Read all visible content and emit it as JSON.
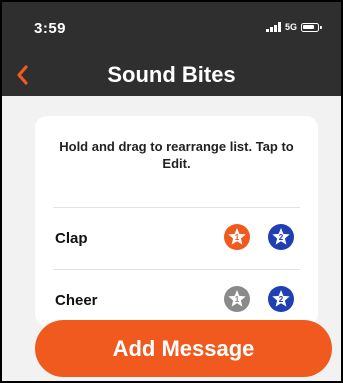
{
  "status_bar": {
    "time": "3:59",
    "network": "5G"
  },
  "nav": {
    "title": "Sound Bites",
    "back_icon": "chevron-left-icon",
    "back_color": "#f05a1f"
  },
  "card": {
    "instruction": "Hold and drag to rearrange list. Tap to Edit.",
    "items": [
      {
        "label": "Clap",
        "badges": [
          {
            "number": "1",
            "fill": "#f05a1f",
            "icon": "star-icon"
          },
          {
            "number": "2",
            "fill": "#1f3fb3",
            "icon": "star-icon"
          }
        ]
      },
      {
        "label": "Cheer",
        "badges": [
          {
            "number": "1",
            "fill": "#8a8a8a",
            "icon": "star-icon"
          },
          {
            "number": "2",
            "fill": "#1f3fb3",
            "icon": "star-icon"
          }
        ]
      }
    ]
  },
  "footer": {
    "add_label": "Add Message",
    "accent": "#f05a1f"
  }
}
